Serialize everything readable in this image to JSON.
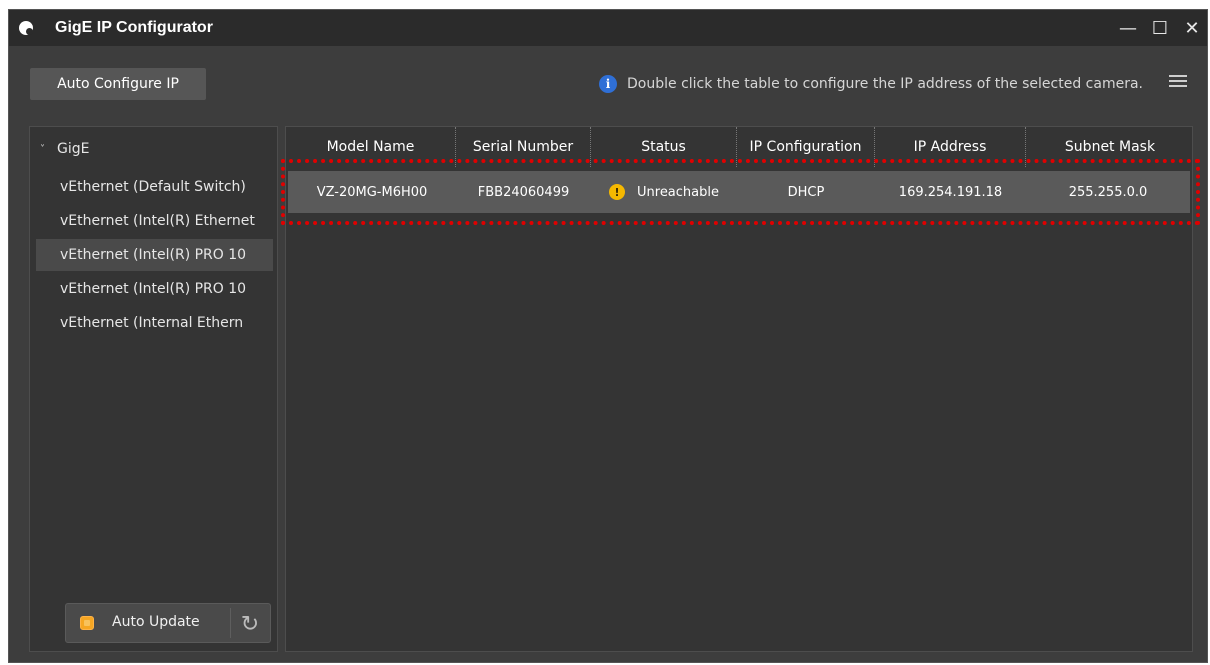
{
  "window": {
    "title": "GigE IP Configurator",
    "controls": {
      "minimize": "—",
      "maximize": "☐",
      "close": "✕"
    }
  },
  "toolbar": {
    "auto_config_label": "Auto Configure IP",
    "info_icon": "i",
    "info_text": "Double click the table to configure the IP address of the selected camera."
  },
  "sidebar": {
    "root_label": "GigE",
    "items": [
      {
        "label": "vEthernet (Default Switch)"
      },
      {
        "label": "vEthernet (Intel(R) Ethernet"
      },
      {
        "label": "vEthernet (Intel(R) PRO 10"
      },
      {
        "label": "vEthernet (Intel(R) PRO 10"
      },
      {
        "label": "vEthernet (Internal Ethern"
      }
    ],
    "selected_index": 2,
    "auto_update": {
      "label": "Auto Update",
      "checked": true
    }
  },
  "table": {
    "columns": [
      "Model Name",
      "Serial Number",
      "Status",
      "IP Configuration",
      "IP Address",
      "Subnet Mask"
    ],
    "rows": [
      {
        "model_name": "VZ-20MG-M6H00",
        "serial_number": "FBB24060499",
        "status": "Unreachable",
        "status_icon": "!",
        "ip_configuration": "DHCP",
        "ip_address": "169.254.191.18",
        "subnet_mask": "255.255.0.0"
      }
    ]
  },
  "colors": {
    "accent_info": "#2f6fd6",
    "warning": "#f5b800",
    "highlight": "#e00000",
    "checkbox": "#f5a623"
  }
}
